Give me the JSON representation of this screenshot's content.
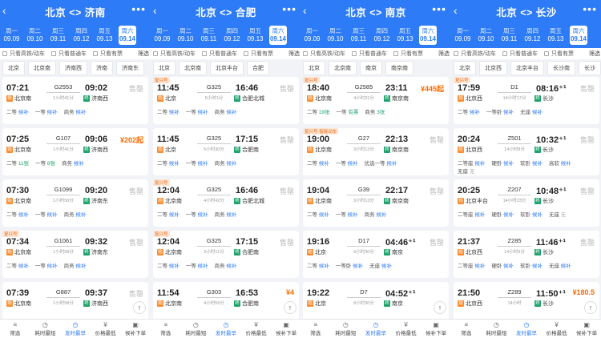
{
  "accent": "#2d7bf6",
  "icons": {
    "back": "chevron-left-icon",
    "more": "more-dots-icon",
    "filter": "filter-icon",
    "top": "arrow-up-icon"
  },
  "panels": [
    {
      "route": "北京 <> 济南",
      "dates": [
        {
          "w": "周一",
          "d": "09.09"
        },
        {
          "w": "周二",
          "d": "09.10"
        },
        {
          "w": "周三",
          "d": "09.11"
        },
        {
          "w": "周四",
          "d": "09.12"
        },
        {
          "w": "周五",
          "d": "09.13"
        },
        {
          "w": "周六",
          "d": "09.14",
          "sel": true
        }
      ],
      "filters": [
        "只看高铁/动车",
        "只看普通车",
        "只看有票"
      ],
      "filter_btn": "筛选",
      "stations": [
        "北京",
        "北京南",
        "济南西",
        "济南",
        "济南东"
      ],
      "trains": [
        {
          "dep": "07:21",
          "no": "G2553",
          "dur": "1小时41分",
          "arr": "09:02",
          "from": "北京南",
          "to": "济南西",
          "fromType": "shi",
          "toType": "zhong",
          "right": "售罄",
          "price": "",
          "tag": "",
          "seats": [
            {
              "n": "二等",
              "s": "候补",
              "c": "b"
            },
            {
              "n": "一等",
              "s": "候补",
              "c": "b"
            },
            {
              "n": "商务",
              "s": "候补",
              "c": "b"
            }
          ]
        },
        {
          "dep": "07:25",
          "no": "G107",
          "dur": "1小时41分",
          "arr": "09:06",
          "from": "北京南",
          "to": "济南西",
          "fromType": "shi",
          "toType": "zhong",
          "right": "",
          "price": "¥202起",
          "tag": "",
          "seats": [
            {
              "n": "二等",
              "s": "11张",
              "c": "i"
            },
            {
              "n": "一等",
              "s": "8张",
              "c": "i"
            },
            {
              "n": "商务",
              "s": "候补",
              "c": "b"
            }
          ]
        },
        {
          "dep": "07:30",
          "no": "G1099",
          "dur": "1小时50分",
          "arr": "09:20",
          "from": "北京南",
          "to": "济南东",
          "fromType": "shi",
          "toType": "zhong",
          "right": "售罄",
          "price": "",
          "tag": "",
          "seats": [
            {
              "n": "二等",
              "s": "候补",
              "c": "b"
            },
            {
              "n": "一等",
              "s": "候补",
              "c": "b"
            },
            {
              "n": "商务",
              "s": "候补",
              "c": "b"
            }
          ]
        },
        {
          "dep": "07:34",
          "no": "G1061",
          "dur": "1小时58分",
          "arr": "09:32",
          "from": "北京南",
          "to": "济南东",
          "fromType": "shi",
          "toType": "zhong",
          "right": "售罄",
          "price": "",
          "tag": "复兴号",
          "seats": [
            {
              "n": "二等",
              "s": "候补",
              "c": "b"
            },
            {
              "n": "一等",
              "s": "候补",
              "c": "b"
            },
            {
              "n": "商务",
              "s": "候补",
              "c": "b"
            }
          ]
        },
        {
          "dep": "07:39",
          "no": "G887",
          "dur": "1小时58分",
          "arr": "09:37",
          "from": "北京南",
          "to": "济南西",
          "fromType": "shi",
          "toType": "zhong",
          "right": "售罄",
          "price": "",
          "tag": "",
          "seats": []
        }
      ]
    },
    {
      "route": "北京 <> 合肥",
      "dates": [
        {
          "w": "周一",
          "d": "09.09"
        },
        {
          "w": "周二",
          "d": "09.10"
        },
        {
          "w": "周三",
          "d": "09.11"
        },
        {
          "w": "周四",
          "d": "09.12"
        },
        {
          "w": "周五",
          "d": "09.13"
        },
        {
          "w": "周六",
          "d": "09.14",
          "sel": true
        }
      ],
      "filters": [
        "只看高铁/动车",
        "只看普通车",
        "只看有票"
      ],
      "filter_btn": "筛选",
      "stations": [
        "北京",
        "北京南",
        "北京丰台",
        "合肥"
      ],
      "trains": [
        {
          "dep": "11:45",
          "no": "G325",
          "dur": "5小时1分",
          "arr": "16:46",
          "from": "北京",
          "to": "合肥北城",
          "fromType": "shi",
          "toType": "zhong",
          "right": "售罄",
          "price": "",
          "tag": "复兴号",
          "seats": [
            {
              "n": "二等",
              "s": "候补",
              "c": "b"
            },
            {
              "n": "一等",
              "s": "候补",
              "c": "b"
            },
            {
              "n": "商务",
              "s": "候补",
              "c": "b"
            }
          ]
        },
        {
          "dep": "11:45",
          "no": "G325",
          "dur": "5小时30分",
          "arr": "17:15",
          "from": "北京",
          "to": "合肥南",
          "fromType": "shi",
          "toType": "zhong",
          "right": "售罄",
          "price": "",
          "tag": "",
          "seats": [
            {
              "n": "二等",
              "s": "候补",
              "c": "b"
            },
            {
              "n": "一等",
              "s": "候补",
              "c": "b"
            },
            {
              "n": "商务",
              "s": "候补",
              "c": "b"
            }
          ]
        },
        {
          "dep": "12:04",
          "no": "G325",
          "dur": "4小时42分",
          "arr": "16:46",
          "from": "北京南",
          "to": "合肥北城",
          "fromType": "shi",
          "toType": "zhong",
          "right": "售罄",
          "price": "",
          "tag": "复兴号",
          "seats": [
            {
              "n": "二等",
              "s": "候补",
              "c": "b"
            },
            {
              "n": "一等",
              "s": "候补",
              "c": "b"
            },
            {
              "n": "商务",
              "s": "候补",
              "c": "b"
            }
          ]
        },
        {
          "dep": "12:04",
          "no": "G325",
          "dur": "5小时11分",
          "arr": "17:15",
          "from": "北京南",
          "to": "合肥南",
          "fromType": "shi",
          "toType": "zhong",
          "right": "售罄",
          "price": "",
          "tag": "复兴号",
          "seats": [
            {
              "n": "二等",
              "s": "候补",
              "c": "b"
            },
            {
              "n": "一等",
              "s": "候补",
              "c": "b"
            },
            {
              "n": "商务",
              "s": "候补",
              "c": "b"
            }
          ]
        },
        {
          "dep": "11:54",
          "no": "G303",
          "dur": "4小时59分",
          "arr": "16:53",
          "from": "北京南",
          "to": "合肥南",
          "fromType": "shi",
          "toType": "zhong",
          "right": "",
          "price": "¥4",
          "tag": "",
          "seats": []
        }
      ]
    },
    {
      "route": "北京 <> 南京",
      "dates": [
        {
          "w": "周一",
          "d": "09.09"
        },
        {
          "w": "周二",
          "d": "09.10"
        },
        {
          "w": "周三",
          "d": "09.11"
        },
        {
          "w": "周四",
          "d": "09.12"
        },
        {
          "w": "周五",
          "d": "09.13"
        },
        {
          "w": "周六",
          "d": "09.14",
          "sel": true
        }
      ],
      "filters": [
        "只看高铁/动车",
        "只看普通车",
        "只看有票"
      ],
      "filter_btn": "筛选",
      "stations": [
        "北京",
        "北京南",
        "南京",
        "南京南"
      ],
      "trains": [
        {
          "dep": "18:40",
          "no": "G2585",
          "dur": "4小时31分",
          "arr": "23:11",
          "from": "北京南",
          "to": "南京南",
          "fromType": "shi",
          "toType": "zhong",
          "right": "",
          "price": "¥445起",
          "tag": "复兴号",
          "seats": [
            {
              "n": "二等",
              "s": "19张",
              "c": "i"
            },
            {
              "n": "一等",
              "s": "有票",
              "c": "i"
            },
            {
              "n": "商务",
              "s": "3张",
              "c": "i"
            }
          ]
        },
        {
          "dep": "19:00",
          "no": "G27",
          "dur": "3小时13分",
          "arr": "22:13",
          "from": "北京南",
          "to": "南京南",
          "fromType": "shi",
          "toType": "zhong",
          "right": "售罄",
          "price": "",
          "tag": "复兴号·智能动车",
          "seats": [
            {
              "n": "二等",
              "s": "候补",
              "c": "b"
            },
            {
              "n": "一等",
              "s": "候补",
              "c": "b"
            },
            {
              "n": "优选一等",
              "s": "候补",
              "c": "b"
            }
          ]
        },
        {
          "dep": "19:04",
          "no": "G39",
          "dur": "3小时13分",
          "arr": "22:17",
          "from": "北京南",
          "to": "南京南",
          "fromType": "shi",
          "toType": "zhong",
          "right": "售罄",
          "price": "",
          "tag": "",
          "seats": [
            {
              "n": "二等",
              "s": "候补",
              "c": "b"
            },
            {
              "n": "一等",
              "s": "候补",
              "c": "b"
            },
            {
              "n": "商务",
              "s": "候补",
              "c": "b"
            }
          ]
        },
        {
          "dep": "19:16",
          "no": "D17",
          "dur": "9小时30分",
          "arr": "04:46⁺¹",
          "from": "北京",
          "to": "南京",
          "fromType": "shi",
          "toType": "zhong",
          "right": "售罄",
          "price": "",
          "tag": "",
          "seats": [
            {
              "n": "二等",
              "s": "候补",
              "c": "b"
            },
            {
              "n": "一等卧",
              "s": "候补",
              "c": "b"
            },
            {
              "n": "无座",
              "s": "候补",
              "c": "b"
            }
          ]
        },
        {
          "dep": "19:22",
          "no": "D7",
          "dur": "9小时30分",
          "arr": "04:52⁺¹",
          "from": "北京",
          "to": "南京",
          "fromType": "shi",
          "toType": "zhong",
          "right": "",
          "price": "",
          "tag": "",
          "seats": []
        }
      ]
    },
    {
      "route": "北京 <> 长沙",
      "dates": [
        {
          "w": "周一",
          "d": "09.09"
        },
        {
          "w": "周二",
          "d": "09.10"
        },
        {
          "w": "周三",
          "d": "09.11"
        },
        {
          "w": "周四",
          "d": "09.12"
        },
        {
          "w": "周五",
          "d": "09.13"
        },
        {
          "w": "周六",
          "d": "09.14",
          "sel": true
        }
      ],
      "filters": [
        "只看高铁/动车",
        "只看普通车",
        "只看有票"
      ],
      "filter_btn": "筛选",
      "stations": [
        "北京",
        "北京西",
        "北京丰台",
        "长沙南",
        "长沙"
      ],
      "trains": [
        {
          "dep": "17:59",
          "no": "D1",
          "dur": "14小时17分",
          "arr": "08:16⁺¹",
          "from": "北京西",
          "to": "长沙",
          "fromType": "shi",
          "toType": "zhong",
          "right": "售罄",
          "price": "",
          "tag": "复兴号",
          "seats": [
            {
              "n": "二等",
              "s": "候补",
              "c": "b"
            },
            {
              "n": "一等卧",
              "s": "候补",
              "c": "b"
            },
            {
              "n": "无座",
              "s": "候补",
              "c": "b"
            }
          ]
        },
        {
          "dep": "20:24",
          "no": "Z501",
          "dur": "14小时8分",
          "arr": "10:32⁺¹",
          "from": "北京西",
          "to": "长沙",
          "fromType": "shi",
          "toType": "zhong",
          "right": "售罄",
          "price": "",
          "tag": "",
          "seats": [
            {
              "n": "二等座",
              "s": "候补",
              "c": "b"
            },
            {
              "n": "硬卧",
              "s": "候补",
              "c": "b"
            },
            {
              "n": "软卧",
              "s": "候补",
              "c": "b"
            },
            {
              "n": "高软",
              "s": "候补",
              "c": "b"
            },
            {
              "n": "无座",
              "s": "无",
              "c": "e"
            }
          ]
        },
        {
          "dep": "20:25",
          "no": "Z207",
          "dur": "14小时23分",
          "arr": "10:48⁺¹",
          "from": "北京丰台",
          "to": "长沙",
          "fromType": "shi",
          "toType": "zhong",
          "right": "售罄",
          "price": "",
          "tag": "",
          "seats": [
            {
              "n": "二等座",
              "s": "候补",
              "c": "b"
            },
            {
              "n": "硬卧",
              "s": "候补",
              "c": "b"
            },
            {
              "n": "软卧",
              "s": "候补",
              "c": "b"
            },
            {
              "n": "无座",
              "s": "无",
              "c": "e"
            }
          ]
        },
        {
          "dep": "21:37",
          "no": "Z285",
          "dur": "14小时9分",
          "arr": "11:46⁺¹",
          "from": "北京西",
          "to": "长沙",
          "fromType": "shi",
          "toType": "zhong",
          "right": "售罄",
          "price": "",
          "tag": "",
          "seats": [
            {
              "n": "二等座",
              "s": "候补",
              "c": "b"
            },
            {
              "n": "硬卧",
              "s": "候补",
              "c": "b"
            },
            {
              "n": "软卧",
              "s": "候补",
              "c": "b"
            },
            {
              "n": "无座",
              "s": "候补",
              "c": "b"
            }
          ]
        },
        {
          "dep": "21:50",
          "no": "Z289",
          "dur": "14小时",
          "arr": "11:50⁺¹",
          "from": "北京西",
          "to": "长沙",
          "fromType": "shi",
          "toType": "zhong",
          "right": "",
          "price": "¥180.5",
          "tag": "",
          "seats": []
        }
      ]
    }
  ],
  "bottom_bar": [
    {
      "label": "筛选",
      "icon": "filter-icon",
      "active": false
    },
    {
      "label": "耗时最短",
      "icon": "clock-icon",
      "active": false
    },
    {
      "label": "发时最早",
      "icon": "clock-icon",
      "active": true
    },
    {
      "label": "价格最低",
      "icon": "price-icon",
      "active": false
    },
    {
      "label": "候补下单",
      "icon": "cart-icon",
      "active": false
    }
  ],
  "station_badges": {
    "shi": "始",
    "guo": "过",
    "zhong": "终"
  }
}
